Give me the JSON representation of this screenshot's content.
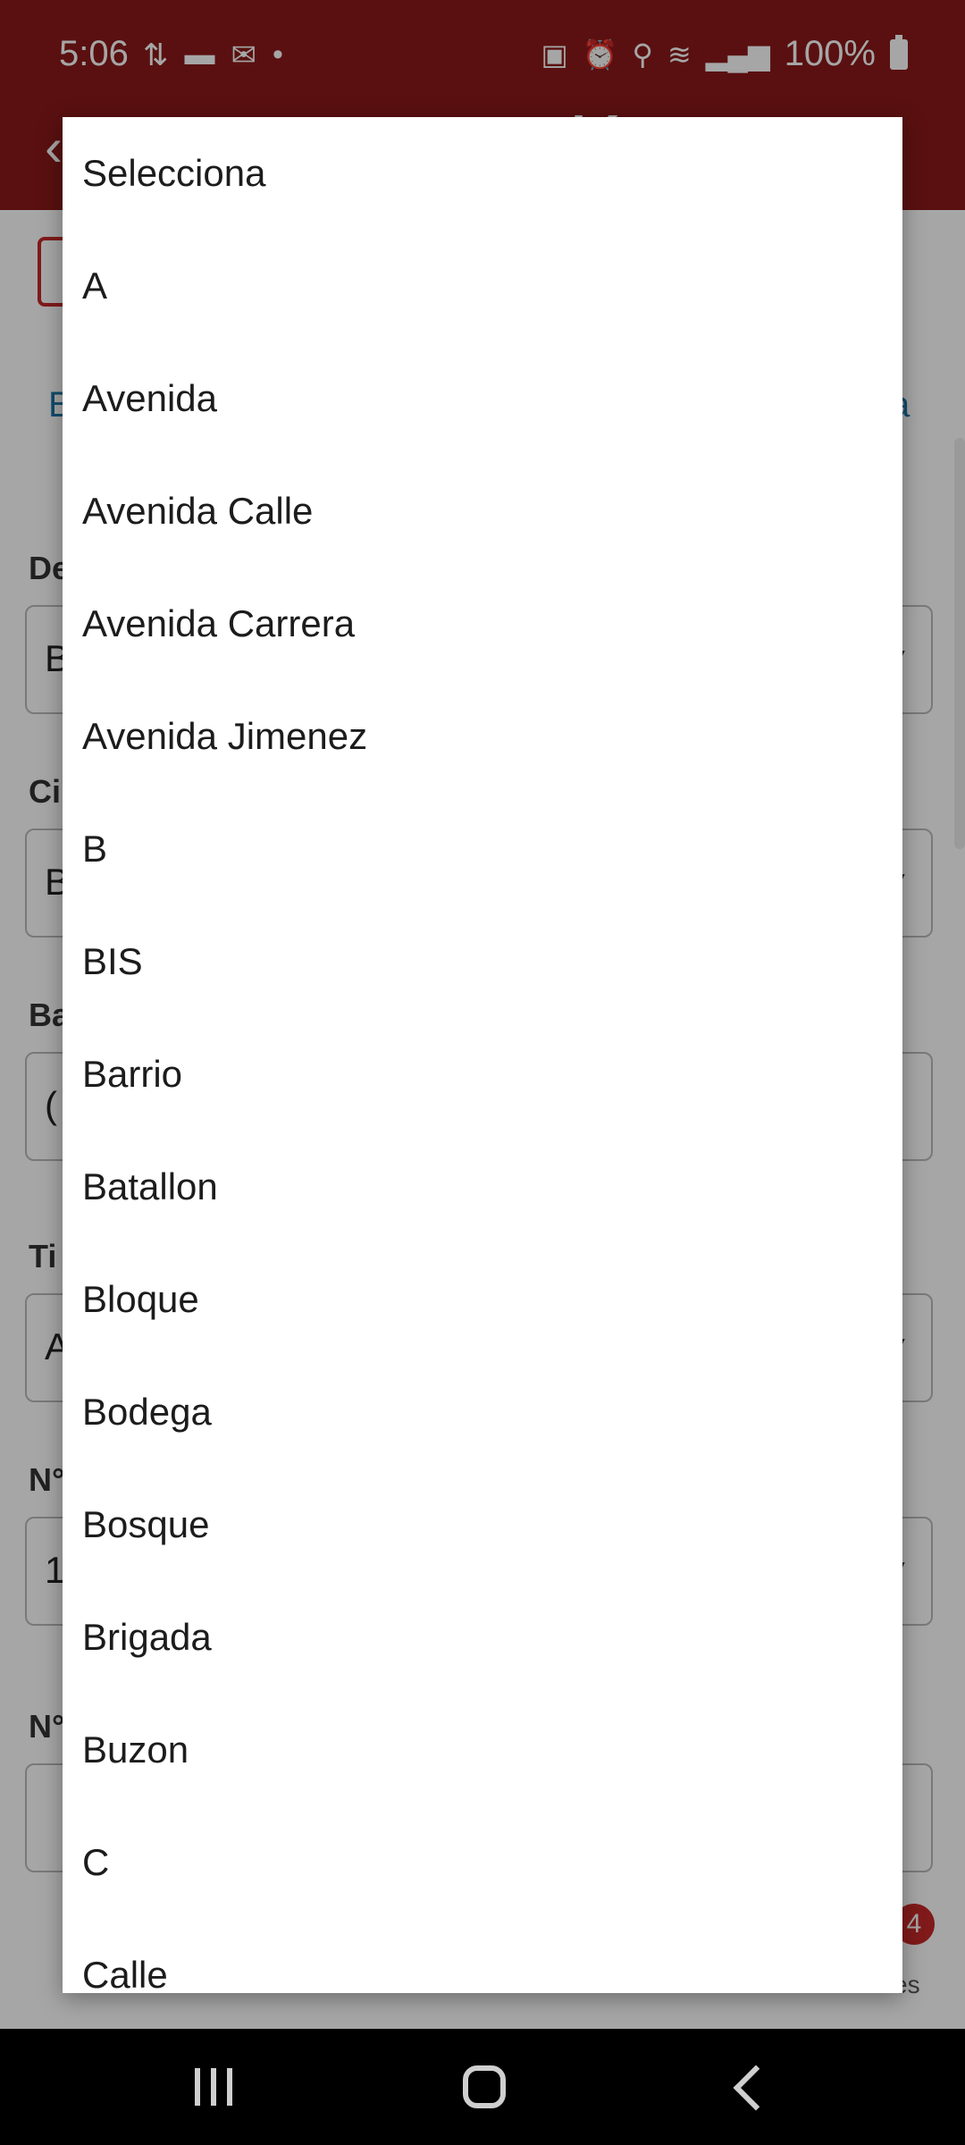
{
  "status_bar": {
    "time": "5:06",
    "battery": "100%"
  },
  "background_form": {
    "link_left": "B",
    "link_right": "a",
    "fields": [
      {
        "label": "De",
        "value": "B"
      },
      {
        "label": "Ci",
        "value": "B"
      },
      {
        "label": "Ba",
        "value": "("
      },
      {
        "label": "Ti",
        "value": "A"
      },
      {
        "label": "N°",
        "value": "1"
      },
      {
        "label": "N°",
        "value": ""
      }
    ],
    "badge_count": "4",
    "bottom_text": "es"
  },
  "dropdown": {
    "options": [
      "Selecciona",
      "A",
      "Avenida",
      "Avenida Calle",
      "Avenida Carrera",
      "Avenida Jimenez",
      "B",
      "BIS",
      "Barrio",
      "Batallon",
      "Bloque",
      "Bodega",
      "Bosque",
      "Brigada",
      "Buzon",
      "C",
      "Calle"
    ]
  }
}
